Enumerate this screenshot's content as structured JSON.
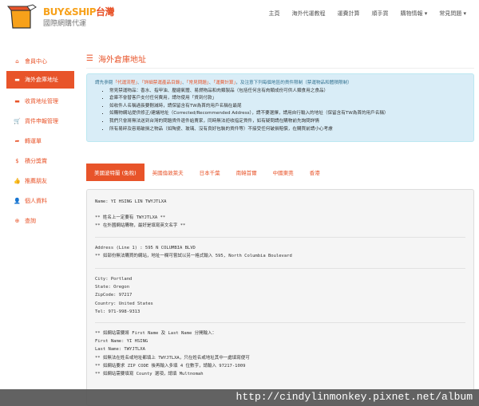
{
  "brand": {
    "name": "BUY&SHIP",
    "region": "台灣",
    "tagline": "國際網購代運",
    "colors": {
      "accent": "#e8542a",
      "logo_orange": "#f7a11a"
    }
  },
  "nav": [
    "主頁",
    "海外代運教程",
    "運費計算",
    "順手買",
    "購物情報 ▾",
    "常見問題 ▾"
  ],
  "sidebar": [
    {
      "icon": "home-icon",
      "glyph": "⌂",
      "label": "會員中心"
    },
    {
      "icon": "address-card-icon",
      "glyph": "▬",
      "label": "海外倉庫地址",
      "active": true
    },
    {
      "icon": "address-card-icon",
      "glyph": "▬",
      "label": "收貨地址管理"
    },
    {
      "icon": "cart-icon",
      "glyph": "🛒",
      "label": "貨件申報管理"
    },
    {
      "icon": "share-icon",
      "glyph": "➦",
      "label": "轉運單"
    },
    {
      "icon": "dollar-icon",
      "glyph": "$",
      "label": "積分獎賞"
    },
    {
      "icon": "thumbs-up-icon",
      "glyph": "👍",
      "label": "推薦朋友"
    },
    {
      "icon": "user-icon",
      "glyph": "👤",
      "label": "個人資料"
    },
    {
      "icon": "lifebuoy-icon",
      "glyph": "⊕",
      "label": "查詢"
    }
  ],
  "page_title": "海外倉庫地址",
  "info": {
    "intro_pre": "請先參閱",
    "links": [
      "「代運流程」",
      "「詳細禁運產品目錄」",
      "「常見問題」",
      "「運費計算」"
    ],
    "sep": "、",
    "intro_post": "，及注意下列每個地區的貨件限制（禁運物品和體積限制）",
    "bullets": [
      "常見禁運物品：香水、指甲油、壓縮氣體、易燃物品和肉類製品（包括任何含有肉類成份可供人類食用之食品）",
      "倉庫不會替客戶支付任何費用，請勿使用「貨到付款」",
      "如收件人名稱過長要刪減時，請保留含有TW為首的用戶名稱在最尾",
      "如購物網站提供修正/建議地址（Corrected/Recommended Address），請不要選擇，請用自行輸入的地址（保留含有TW為首的用戶名稱）",
      "我們只會將無法送到台灣的問題貨件退件給賣家，同時無法拒收指定貨件，如有疑問請在購物前先詢問詳情",
      "所有易碎及容易破損之物品（如陶瓷、玻璃、沒有良好包裝的貨件等）不接受任何破損賠償，在購買前請小心考慮"
    ]
  },
  "tabs": [
    "美國波特蘭 (免稅)",
    "英國倫敦萊夫",
    "日本千葉",
    "南韓首爾",
    "中國東莞",
    "香港"
  ],
  "address": {
    "name": "Name: YI HSING LIN TWYJTLXA",
    "note1": "** 姓名上一定要有 TWYJTLXA **",
    "note2": "** 在外國網站購物，最好是填寫英文名字 **",
    "line1": "Address (Line 1) : 595 N COLUMBIA BLVD",
    "line1_note": "** 如部份無法購買的網站，地址一欄可嘗試以另一格式輸入 595, North Columbia Boulevard",
    "city": "City: Portland",
    "state": "State: Oregon",
    "zip": "ZipCode: 97217",
    "country": "Country: United States",
    "tel": "Tel: 971-998-9313",
    "split_note": "** 如網站需要將 First Name 及 Last Name 分開輸入：",
    "first": "First Name: YI HSING",
    "last": "Last Name: TWYJTLXA",
    "n1": "** 如無法在姓名或地址都填上 TWYJTLXA，只在姓名或地址其中一處填寫便可",
    "n2": "** 如網站要求 ZIP CODE 後再輸入多填 4 位數字，請輸入 97217-1009",
    "n3": "** 如網站需要填寫 County 選項，請填 Multnomah"
  },
  "watermark": "http://cindylinmonkey.pixnet.net/album"
}
